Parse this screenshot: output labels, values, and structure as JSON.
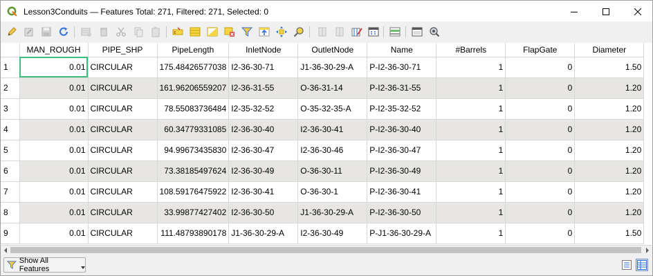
{
  "window": {
    "title": "Lesson3Conduits — Features Total: 271, Filtered: 271, Selected: 0",
    "app_icon": "qgis-icon",
    "brand_color": "#589632",
    "controls": [
      "minimize-icon",
      "maximize-icon",
      "close-icon"
    ]
  },
  "toolbar": {
    "buttons": [
      {
        "name": "toggle-editing-button",
        "icon": "pencil-icon"
      },
      {
        "name": "toggle-multi-edit-button",
        "icon": "multi-edit-icon"
      },
      {
        "name": "save-edits-button",
        "icon": "save-icon"
      },
      {
        "name": "reload-table-button",
        "icon": "reload-icon"
      },
      {
        "name": "add-feature-button",
        "icon": "add-feature-icon"
      },
      {
        "name": "delete-selected-button",
        "icon": "delete-icon"
      },
      {
        "name": "cut-button",
        "icon": "scissors-icon"
      },
      {
        "name": "copy-button",
        "icon": "copy-icon"
      },
      {
        "name": "paste-button",
        "icon": "paste-icon"
      },
      {
        "name": "select-by-expression-button",
        "icon": "expression-select-icon"
      },
      {
        "name": "select-all-button",
        "icon": "select-all-icon"
      },
      {
        "name": "invert-selection-button",
        "icon": "invert-selection-icon"
      },
      {
        "name": "deselect-all-button",
        "icon": "deselect-icon"
      },
      {
        "name": "filter-select-button",
        "icon": "filter-icon"
      },
      {
        "name": "move-selection-top-button",
        "icon": "move-top-icon"
      },
      {
        "name": "pan-map-to-selection-button",
        "icon": "pan-selection-icon"
      },
      {
        "name": "zoom-map-to-selection-button",
        "icon": "zoom-selection-icon"
      },
      {
        "name": "new-field-button",
        "icon": "new-field-icon"
      },
      {
        "name": "delete-field-button",
        "icon": "delete-field-icon"
      },
      {
        "name": "organize-columns-button",
        "icon": "edit-columns-icon"
      },
      {
        "name": "field-calculator-button",
        "icon": "calculator-icon"
      },
      {
        "name": "conditional-formatting-button",
        "icon": "conditional-format-icon"
      },
      {
        "name": "dock-table-button",
        "icon": "dock-icon"
      },
      {
        "name": "actions-button",
        "icon": "actions-icon"
      }
    ]
  },
  "table": {
    "columns": [
      "MAN_ROUGH",
      "PIPE_SHP",
      "PipeLength",
      "InletNode",
      "OutletNode",
      "Name",
      "#Barrels",
      "FlapGate",
      "Diameter"
    ],
    "rows": [
      {
        "id": "1",
        "cells": [
          "0.01",
          "CIRCULAR",
          "175.48426577038",
          "I2-36-30-71",
          "J1-36-30-29-A",
          "P-I2-36-30-71",
          "1",
          "0",
          "1.50"
        ]
      },
      {
        "id": "2",
        "cells": [
          "0.01",
          "CIRCULAR",
          "161.96206559207",
          "I2-36-31-55",
          "O-36-31-14",
          "P-I2-36-31-55",
          "1",
          "0",
          "1.20"
        ]
      },
      {
        "id": "3",
        "cells": [
          "0.01",
          "CIRCULAR",
          "78.55083736484",
          "I2-35-32-52",
          "O-35-32-35-A",
          "P-I2-35-32-52",
          "1",
          "0",
          "1.20"
        ]
      },
      {
        "id": "4",
        "cells": [
          "0.01",
          "CIRCULAR",
          "60.34779331085",
          "I2-36-30-40",
          "I2-36-30-41",
          "P-I2-36-30-40",
          "1",
          "0",
          "1.20"
        ]
      },
      {
        "id": "5",
        "cells": [
          "0.01",
          "CIRCULAR",
          "94.99673435830",
          "I2-36-30-47",
          "I2-36-30-46",
          "P-I2-36-30-47",
          "1",
          "0",
          "1.20"
        ]
      },
      {
        "id": "6",
        "cells": [
          "0.01",
          "CIRCULAR",
          "73.38185497624",
          "I2-36-30-49",
          "O-36-30-11",
          "P-I2-36-30-49",
          "1",
          "0",
          "1.20"
        ]
      },
      {
        "id": "7",
        "cells": [
          "0.01",
          "CIRCULAR",
          "108.59176475922",
          "I2-36-30-41",
          "O-36-30-1",
          "P-I2-36-30-41",
          "1",
          "0",
          "1.20"
        ]
      },
      {
        "id": "8",
        "cells": [
          "0.01",
          "CIRCULAR",
          "33.99877427402",
          "I2-36-30-50",
          "J1-36-30-29-A",
          "P-I2-36-30-50",
          "1",
          "0",
          "1.20"
        ]
      },
      {
        "id": "9",
        "cells": [
          "0.01",
          "CIRCULAR",
          "111.48793890178",
          "J1-36-30-29-A",
          "I2-36-30-49",
          "P-J1-36-30-29-A",
          "1",
          "0",
          "1.50"
        ]
      }
    ],
    "selected_cell_color": "#3bbd80",
    "alt_row_color": "#e8e6e3"
  },
  "bottom": {
    "filter_button_label": "Show All Features",
    "filter_icon": "filter-icon",
    "view_buttons": [
      "form-view-icon",
      "table-view-icon"
    ]
  }
}
